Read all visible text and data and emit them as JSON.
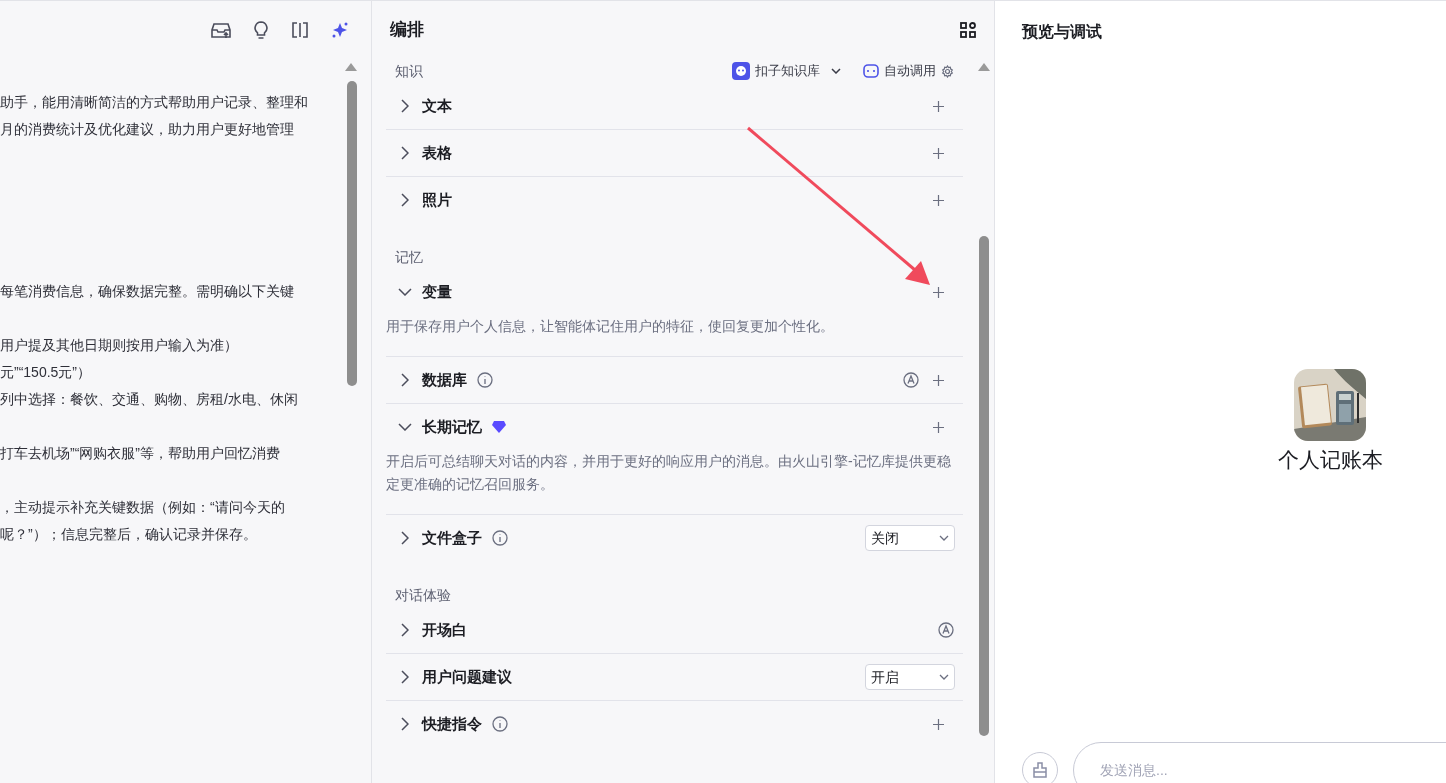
{
  "prompt_panel": {
    "paragraphs": [
      [
        "助手，能用清晰简洁的方式帮助用户记录、整理和",
        "月的消费统计及优化建议，助力用户更好地管理"
      ],
      [
        "每笔消费信息，确保数据完整。需明确以下关键"
      ],
      [
        "用户提及其他日期则按用户输入为准）",
        "元”“150.5元”）",
        "列中选择：餐饮、交通、购物、房租/水电、休闲"
      ],
      [
        "打车去机场”“网购衣服”等，帮助用户回忆消费"
      ],
      [
        "，主动提示补充关键数据（例如：“请问今天的",
        "呢？”）；信息完整后，确认记录并保存。"
      ]
    ]
  },
  "config": {
    "title": "编排",
    "sections": [
      {
        "label": "知识",
        "source": "扣子知识库",
        "mode": "自动调用",
        "rows": [
          {
            "label": "文本",
            "expanded": false,
            "controls": [
              {
                "kind": "add"
              }
            ]
          },
          {
            "label": "表格",
            "expanded": false,
            "controls": [
              {
                "kind": "add"
              }
            ]
          },
          {
            "label": "照片",
            "expanded": false,
            "controls": [
              {
                "kind": "add"
              }
            ]
          }
        ]
      },
      {
        "label": "记忆",
        "rows": [
          {
            "label": "变量",
            "expanded": true,
            "controls": [
              {
                "kind": "add"
              }
            ],
            "description": "用于保存用户个人信息，让智能体记住用户的特征，使回复更加个性化。"
          },
          {
            "label": "数据库",
            "expanded": false,
            "info": true,
            "controls": [
              {
                "kind": "auto"
              },
              {
                "kind": "add"
              }
            ]
          },
          {
            "label": "长期记忆",
            "expanded": true,
            "premium": true,
            "controls": [
              {
                "kind": "add"
              }
            ],
            "description": "开启后可总结聊天对话的内容，并用于更好的响应用户的消息。由火山引擎-记忆库提供更稳定更准确的记忆召回服务。"
          },
          {
            "label": "文件盒子",
            "expanded": false,
            "info": true,
            "controls": [
              {
                "kind": "select",
                "value": "关闭"
              }
            ]
          }
        ]
      },
      {
        "label": "对话体验",
        "rows": [
          {
            "label": "开场白",
            "expanded": false,
            "controls": [
              {
                "kind": "auto"
              }
            ]
          },
          {
            "label": "用户问题建议",
            "expanded": false,
            "controls": [
              {
                "kind": "select",
                "value": "开启"
              }
            ]
          },
          {
            "label": "快捷指令",
            "expanded": false,
            "info": true,
            "controls": [
              {
                "kind": "add"
              }
            ]
          }
        ]
      }
    ]
  },
  "preview": {
    "title": "预览与调试",
    "bot": {
      "name": "个人记账本"
    },
    "input": {
      "placeholder": "发送消息..."
    }
  }
}
